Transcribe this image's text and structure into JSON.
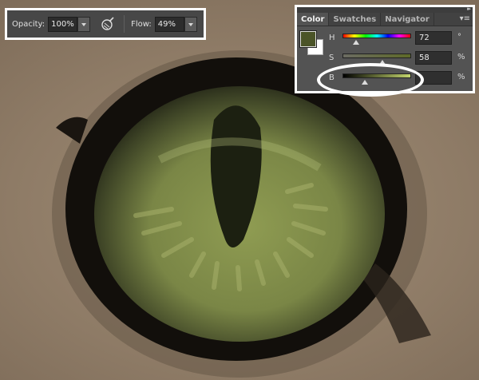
{
  "options_bar": {
    "opacity_label": "Opacity:",
    "opacity_value": "100%",
    "airbrush_icon": "airbrush-icon",
    "flow_label": "Flow:",
    "flow_value": "49%"
  },
  "color_panel": {
    "tabs": [
      "Color",
      "Swatches",
      "Navigator"
    ],
    "active_tab": "Color",
    "foreground_color": "#4b5428",
    "background_color": "#ffffff",
    "channels": [
      {
        "label": "H",
        "value": "72",
        "unit": "°",
        "level": 0.2
      },
      {
        "label": "S",
        "value": "58",
        "unit": "%",
        "level": 0.58
      },
      {
        "label": "B",
        "value": "",
        "unit": "%",
        "level": 0.33
      }
    ]
  },
  "colors": {
    "iris_green": "#8f9c52",
    "eye_outline": "#120f0b",
    "skin": "#9a8670",
    "panel_bg": "#535353",
    "annotation": "#ffffff"
  }
}
